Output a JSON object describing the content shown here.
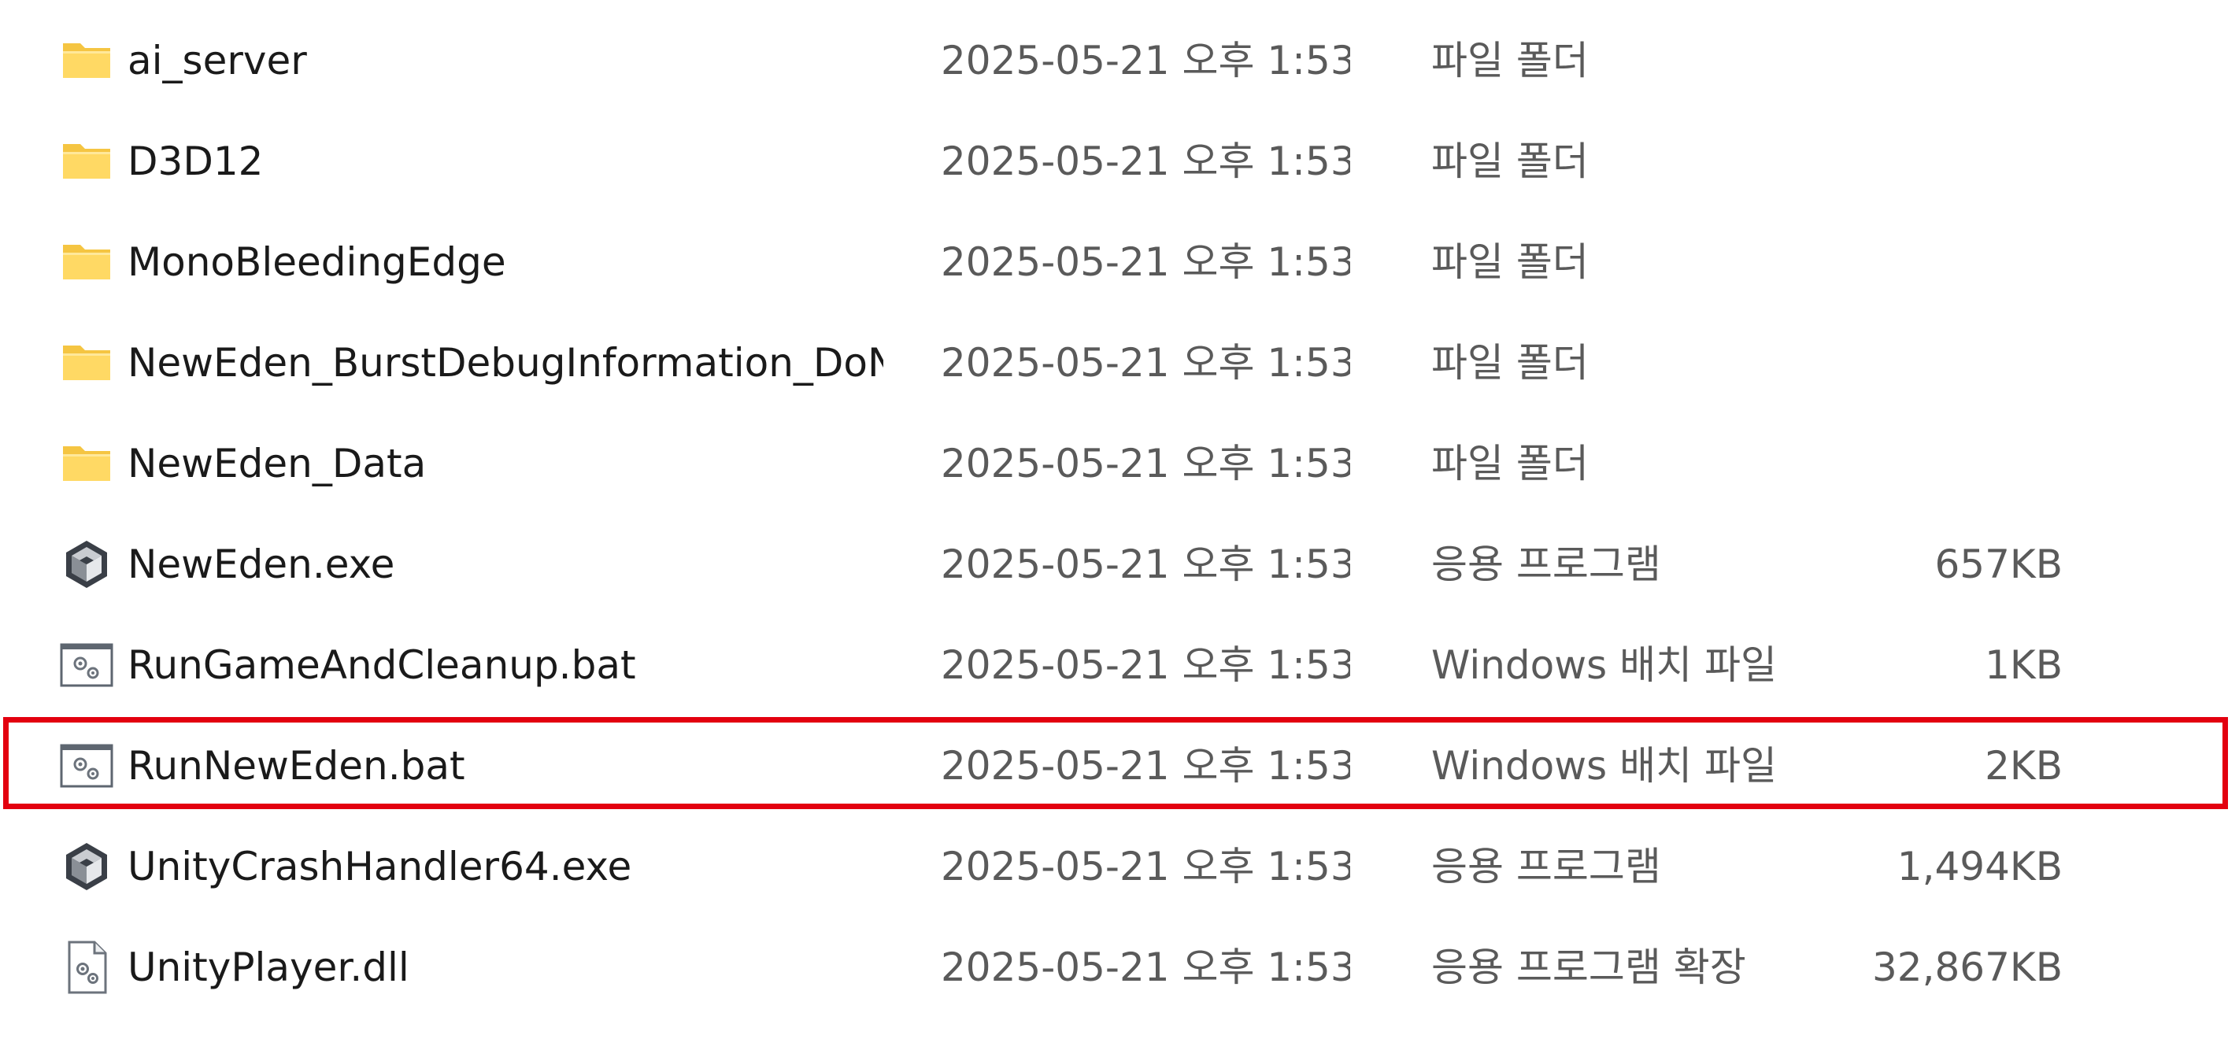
{
  "highlight_color": "#e3000f",
  "files": [
    {
      "icon": "folder-icon",
      "name": "ai_server",
      "date": "2025-05-21 오후 1:53",
      "type": "파일 폴더",
      "size": ""
    },
    {
      "icon": "folder-icon",
      "name": "D3D12",
      "date": "2025-05-21 오후 1:53",
      "type": "파일 폴더",
      "size": ""
    },
    {
      "icon": "folder-icon",
      "name": "MonoBleedingEdge",
      "date": "2025-05-21 오후 1:53",
      "type": "파일 폴더",
      "size": ""
    },
    {
      "icon": "folder-icon",
      "name": "NewEden_BurstDebugInformation_DoN...",
      "date": "2025-05-21 오후 1:53",
      "type": "파일 폴더",
      "size": ""
    },
    {
      "icon": "folder-icon",
      "name": "NewEden_Data",
      "date": "2025-05-21 오후 1:53",
      "type": "파일 폴더",
      "size": ""
    },
    {
      "icon": "unity-exe-icon",
      "name": "NewEden.exe",
      "date": "2025-05-21 오후 1:53",
      "type": "응용 프로그램",
      "size": "657KB"
    },
    {
      "icon": "batch-file-icon",
      "name": "RunGameAndCleanup.bat",
      "date": "2025-05-21 오후 1:53",
      "type": "Windows 배치 파일",
      "size": "1KB"
    },
    {
      "icon": "batch-file-icon",
      "name": "RunNewEden.bat",
      "date": "2025-05-21 오후 1:53",
      "type": "Windows 배치 파일",
      "size": "2KB",
      "highlighted": true
    },
    {
      "icon": "unity-exe-icon",
      "name": "UnityCrashHandler64.exe",
      "date": "2025-05-21 오후 1:53",
      "type": "응용 프로그램",
      "size": "1,494KB"
    },
    {
      "icon": "dll-file-icon",
      "name": "UnityPlayer.dll",
      "date": "2025-05-21 오후 1:53",
      "type": "응용 프로그램 확장",
      "size": "32,867KB"
    }
  ]
}
